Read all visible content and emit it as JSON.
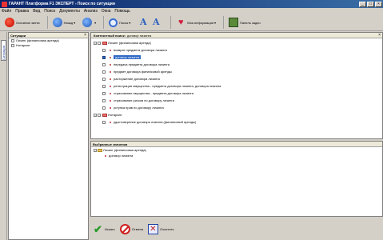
{
  "window": {
    "title": "ГАРАНТ Платформа F1 ЭКСПЕРТ - Поиск по ситуации"
  },
  "menu": [
    "Файл",
    "Правка",
    "Вид",
    "Поиск",
    "Документы",
    "Анализ",
    "Окна",
    "Помощь"
  ],
  "toolbar": {
    "main_menu": "Основное меню",
    "back": "Назад",
    "search": "Поиск",
    "my_info": "Моя информация",
    "desk": "Панель задач"
  },
  "sidebar_tab": {
    "label": "Ситуации"
  },
  "left_panel": {
    "header": "Ситуации",
    "items": [
      "Лизинг (финансовая аренда)",
      "Нотариат"
    ]
  },
  "search": {
    "label": "Контекстный поиск:",
    "query": "договор лизинга"
  },
  "tree": [
    {
      "type": "group",
      "label": "Лизинг (финансовая аренда)"
    },
    {
      "type": "item",
      "label": "возврат предмета договора лизинга"
    },
    {
      "type": "item",
      "label": "договор лизинга",
      "selected": true
    },
    {
      "type": "item",
      "label": "передача предмета договора лизинга"
    },
    {
      "type": "item",
      "label": "предмет договора финансовой аренды"
    },
    {
      "type": "item",
      "label": "расторжение договора лизинга"
    },
    {
      "type": "item",
      "label": "регистрация имущества - предмета договора лизинга, договора лизинга"
    },
    {
      "type": "item",
      "label": "страхование имущества - предмета договора лизинга"
    },
    {
      "type": "item",
      "label": "страхование рисков по договору лизинга"
    },
    {
      "type": "item",
      "label": "уступка прав по договору лизинга"
    },
    {
      "type": "group2",
      "label": "Нотариат"
    },
    {
      "type": "item",
      "label": "удостоверение договора лизинга (финансовой аренды)"
    }
  ],
  "selected_panel": {
    "header": "Выбранные значения",
    "group": "Лизинг (финансовая аренда)",
    "item": "договор лизинга"
  },
  "buttons": {
    "find": "Искать",
    "cancel": "Отмена",
    "clear": "Очистить"
  }
}
